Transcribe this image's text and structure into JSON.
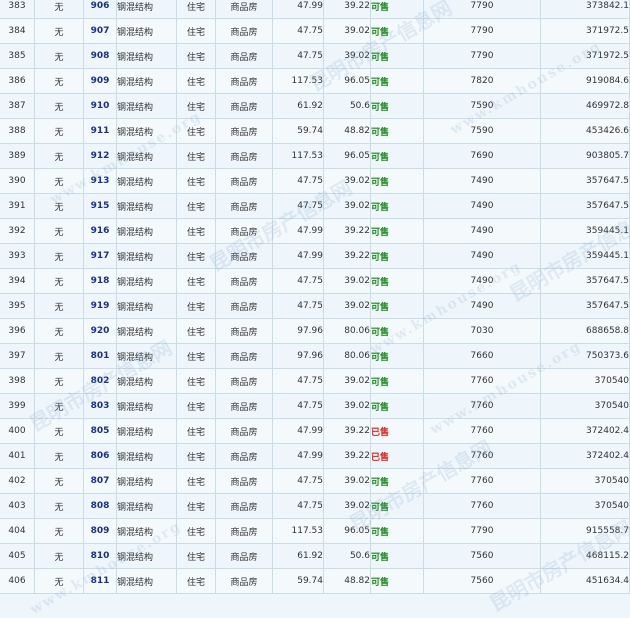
{
  "watermark": {
    "cn": "昆明市房产信息网",
    "en": "www.kmhouse.org"
  },
  "colors": {
    "available": "#1a8a1a",
    "sold": "#e0201a",
    "room_number": "#1a2f8f"
  },
  "rows": [
    {
      "seq": "383",
      "col2": "无",
      "room": "906",
      "structure": "钢混结构",
      "use": "住宅",
      "type": "商品房",
      "area": "47.99",
      "inner_area": "39.22",
      "status": "可售",
      "sold": false,
      "unit_price": "7790",
      "total": "373842.1"
    },
    {
      "seq": "384",
      "col2": "无",
      "room": "907",
      "structure": "钢混结构",
      "use": "住宅",
      "type": "商品房",
      "area": "47.75",
      "inner_area": "39.02",
      "status": "可售",
      "sold": false,
      "unit_price": "7790",
      "total": "371972.5"
    },
    {
      "seq": "385",
      "col2": "无",
      "room": "908",
      "structure": "钢混结构",
      "use": "住宅",
      "type": "商品房",
      "area": "47.75",
      "inner_area": "39.02",
      "status": "可售",
      "sold": false,
      "unit_price": "7790",
      "total": "371972.5"
    },
    {
      "seq": "386",
      "col2": "无",
      "room": "909",
      "structure": "钢混结构",
      "use": "住宅",
      "type": "商品房",
      "area": "117.53",
      "inner_area": "96.05",
      "status": "可售",
      "sold": false,
      "unit_price": "7820",
      "total": "919084.6"
    },
    {
      "seq": "387",
      "col2": "无",
      "room": "910",
      "structure": "钢混结构",
      "use": "住宅",
      "type": "商品房",
      "area": "61.92",
      "inner_area": "50.6",
      "status": "可售",
      "sold": false,
      "unit_price": "7590",
      "total": "469972.8"
    },
    {
      "seq": "388",
      "col2": "无",
      "room": "911",
      "structure": "钢混结构",
      "use": "住宅",
      "type": "商品房",
      "area": "59.74",
      "inner_area": "48.82",
      "status": "可售",
      "sold": false,
      "unit_price": "7590",
      "total": "453426.6"
    },
    {
      "seq": "389",
      "col2": "无",
      "room": "912",
      "structure": "钢混结构",
      "use": "住宅",
      "type": "商品房",
      "area": "117.53",
      "inner_area": "96.05",
      "status": "可售",
      "sold": false,
      "unit_price": "7690",
      "total": "903805.7"
    },
    {
      "seq": "390",
      "col2": "无",
      "room": "913",
      "structure": "钢混结构",
      "use": "住宅",
      "type": "商品房",
      "area": "47.75",
      "inner_area": "39.02",
      "status": "可售",
      "sold": false,
      "unit_price": "7490",
      "total": "357647.5"
    },
    {
      "seq": "391",
      "col2": "无",
      "room": "915",
      "structure": "钢混结构",
      "use": "住宅",
      "type": "商品房",
      "area": "47.75",
      "inner_area": "39.02",
      "status": "可售",
      "sold": false,
      "unit_price": "7490",
      "total": "357647.5"
    },
    {
      "seq": "392",
      "col2": "无",
      "room": "916",
      "structure": "钢混结构",
      "use": "住宅",
      "type": "商品房",
      "area": "47.99",
      "inner_area": "39.22",
      "status": "可售",
      "sold": false,
      "unit_price": "7490",
      "total": "359445.1"
    },
    {
      "seq": "393",
      "col2": "无",
      "room": "917",
      "structure": "钢混结构",
      "use": "住宅",
      "type": "商品房",
      "area": "47.99",
      "inner_area": "39.22",
      "status": "可售",
      "sold": false,
      "unit_price": "7490",
      "total": "359445.1"
    },
    {
      "seq": "394",
      "col2": "无",
      "room": "918",
      "structure": "钢混结构",
      "use": "住宅",
      "type": "商品房",
      "area": "47.75",
      "inner_area": "39.02",
      "status": "可售",
      "sold": false,
      "unit_price": "7490",
      "total": "357647.5"
    },
    {
      "seq": "395",
      "col2": "无",
      "room": "919",
      "structure": "钢混结构",
      "use": "住宅",
      "type": "商品房",
      "area": "47.75",
      "inner_area": "39.02",
      "status": "可售",
      "sold": false,
      "unit_price": "7490",
      "total": "357647.5"
    },
    {
      "seq": "396",
      "col2": "无",
      "room": "920",
      "structure": "钢混结构",
      "use": "住宅",
      "type": "商品房",
      "area": "97.96",
      "inner_area": "80.06",
      "status": "可售",
      "sold": false,
      "unit_price": "7030",
      "total": "688658.8"
    },
    {
      "seq": "397",
      "col2": "无",
      "room": "801",
      "structure": "钢混结构",
      "use": "住宅",
      "type": "商品房",
      "area": "97.96",
      "inner_area": "80.06",
      "status": "可售",
      "sold": false,
      "unit_price": "7660",
      "total": "750373.6"
    },
    {
      "seq": "398",
      "col2": "无",
      "room": "802",
      "structure": "钢混结构",
      "use": "住宅",
      "type": "商品房",
      "area": "47.75",
      "inner_area": "39.02",
      "status": "可售",
      "sold": false,
      "unit_price": "7760",
      "total": "370540"
    },
    {
      "seq": "399",
      "col2": "无",
      "room": "803",
      "structure": "钢混结构",
      "use": "住宅",
      "type": "商品房",
      "area": "47.75",
      "inner_area": "39.02",
      "status": "可售",
      "sold": false,
      "unit_price": "7760",
      "total": "370540"
    },
    {
      "seq": "400",
      "col2": "无",
      "room": "805",
      "structure": "钢混结构",
      "use": "住宅",
      "type": "商品房",
      "area": "47.99",
      "inner_area": "39.22",
      "status": "已售",
      "sold": true,
      "unit_price": "7760",
      "total": "372402.4"
    },
    {
      "seq": "401",
      "col2": "无",
      "room": "806",
      "structure": "钢混结构",
      "use": "住宅",
      "type": "商品房",
      "area": "47.99",
      "inner_area": "39.22",
      "status": "已售",
      "sold": true,
      "unit_price": "7760",
      "total": "372402.4"
    },
    {
      "seq": "402",
      "col2": "无",
      "room": "807",
      "structure": "钢混结构",
      "use": "住宅",
      "type": "商品房",
      "area": "47.75",
      "inner_area": "39.02",
      "status": "可售",
      "sold": false,
      "unit_price": "7760",
      "total": "370540"
    },
    {
      "seq": "403",
      "col2": "无",
      "room": "808",
      "structure": "钢混结构",
      "use": "住宅",
      "type": "商品房",
      "area": "47.75",
      "inner_area": "39.02",
      "status": "可售",
      "sold": false,
      "unit_price": "7760",
      "total": "370540"
    },
    {
      "seq": "404",
      "col2": "无",
      "room": "809",
      "structure": "钢混结构",
      "use": "住宅",
      "type": "商品房",
      "area": "117.53",
      "inner_area": "96.05",
      "status": "可售",
      "sold": false,
      "unit_price": "7790",
      "total": "915558.7"
    },
    {
      "seq": "405",
      "col2": "无",
      "room": "810",
      "structure": "钢混结构",
      "use": "住宅",
      "type": "商品房",
      "area": "61.92",
      "inner_area": "50.6",
      "status": "可售",
      "sold": false,
      "unit_price": "7560",
      "total": "468115.2"
    },
    {
      "seq": "406",
      "col2": "无",
      "room": "811",
      "structure": "钢混结构",
      "use": "住宅",
      "type": "商品房",
      "area": "59.74",
      "inner_area": "48.82",
      "status": "可售",
      "sold": false,
      "unit_price": "7560",
      "total": "451634.4"
    }
  ]
}
